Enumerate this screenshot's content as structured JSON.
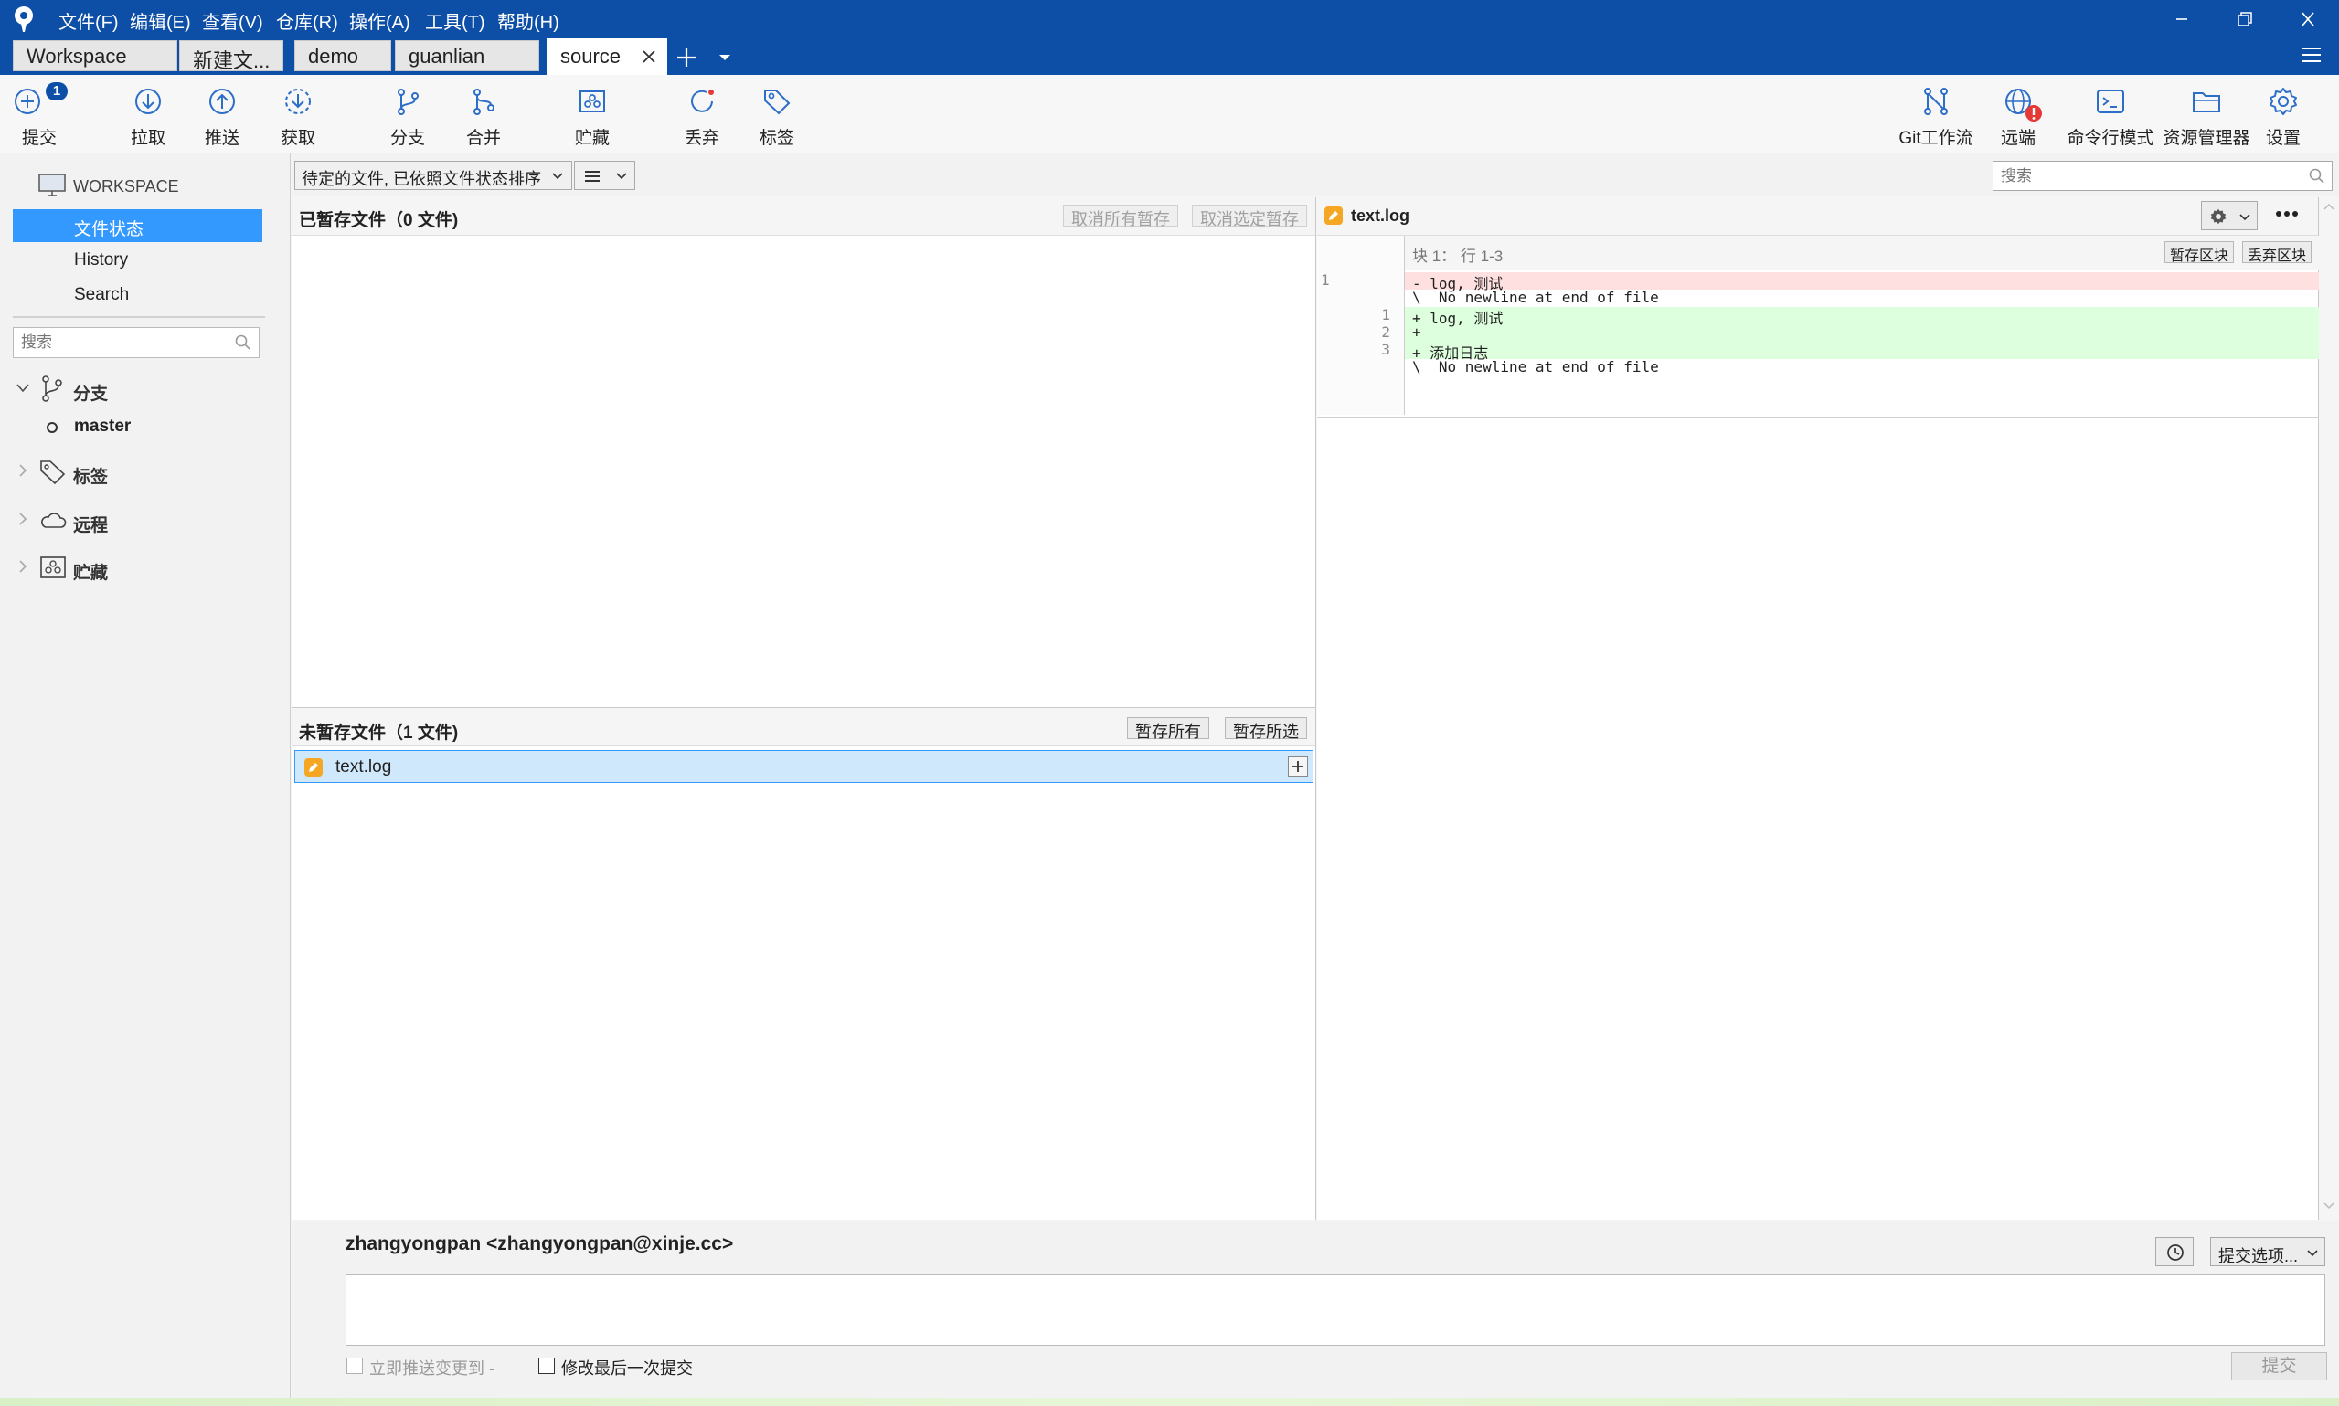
{
  "menu": [
    "文件(F)",
    "编辑(E)",
    "查看(V)",
    "仓库(R)",
    "操作(A)",
    "工具(T)",
    "帮助(H)"
  ],
  "tabs": [
    "Workspace",
    "新建文...",
    "demo",
    "guanlian",
    "source"
  ],
  "toolbar": {
    "commit": "提交",
    "commit_badge": "1",
    "pull": "拉取",
    "push": "推送",
    "fetch": "获取",
    "branch": "分支",
    "merge": "合并",
    "stash": "贮藏",
    "discard": "丢弃",
    "tag": "标签",
    "git_flow": "Git工作流",
    "remote": "远端",
    "terminal": "命令行模式",
    "explorer": "资源管理器",
    "settings": "设置"
  },
  "sidebar": {
    "workspace": "WORKSPACE",
    "file_status": "文件状态",
    "history": "History",
    "search": "Search",
    "search_placeholder": "搜索",
    "branches": "分支",
    "current_branch": "master",
    "tags": "标签",
    "remotes": "远程",
    "stashes": "贮藏"
  },
  "filter": {
    "sort_label": "待定的文件, 已依照文件状态排序",
    "search_placeholder": "搜索"
  },
  "staged": {
    "title": "已暂存文件（0 文件)",
    "unstage_all": "取消所有暂存",
    "unstage_selected": "取消选定暂存"
  },
  "unstaged": {
    "title": "未暂存文件（1 文件)",
    "stage_all": "暂存所有",
    "stage_selected": "暂存所选",
    "files": [
      "text.log"
    ]
  },
  "diff": {
    "filename": "text.log",
    "hunk_header": "块 1： 行 1-3",
    "stage_hunk": "暂存区块",
    "discard_hunk": "丢弃区块",
    "lines": [
      {
        "old": "1",
        "new": "",
        "text": "- log, 测试",
        "kind": "removed"
      },
      {
        "old": "",
        "new": "",
        "text": "\\  No newline at end of file",
        "kind": "context"
      },
      {
        "old": "",
        "new": "1",
        "text": "+ log, 测试",
        "kind": "added"
      },
      {
        "old": "",
        "new": "2",
        "text": "+",
        "kind": "added"
      },
      {
        "old": "",
        "new": "3",
        "text": "+ 添加日志",
        "kind": "added"
      },
      {
        "old": "",
        "new": "",
        "text": "\\  No newline at end of file",
        "kind": "context"
      }
    ]
  },
  "commit": {
    "author": "zhangyongpan <zhangyongpan@xinje.cc>",
    "options": "提交选项...",
    "push_immediately": "立即推送变更到 -",
    "amend": "修改最后一次提交",
    "submit": "提交"
  },
  "colors": {
    "titlebar": "#0d4ea6",
    "accent": "#3399ff",
    "added_bg": "#ddffdd",
    "removed_bg": "#ffe0e0",
    "modified_icon": "#f5a623"
  }
}
